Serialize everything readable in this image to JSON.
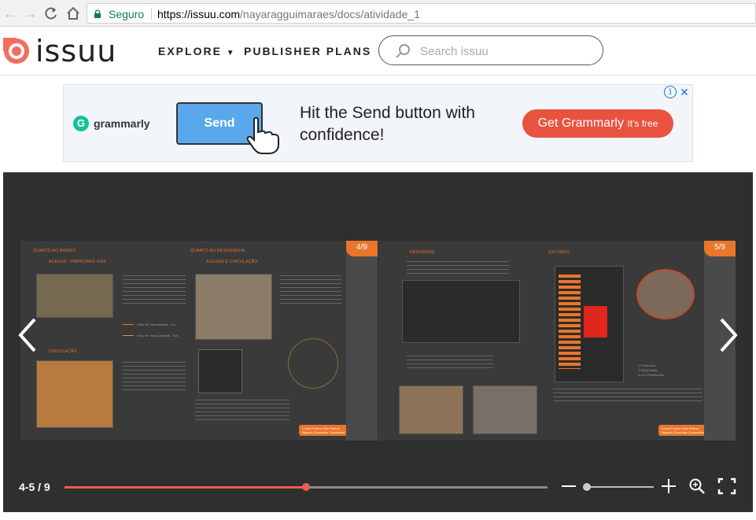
{
  "browser": {
    "secure_label": "Seguro",
    "url_host": "https://issuu.com",
    "url_path": "/nayaragguimaraes/docs/atividade_1"
  },
  "header": {
    "logo_text": "issuu",
    "nav": {
      "explore": "EXPLORE",
      "publisher_plans": "PUBLISHER PLANS"
    },
    "search_placeholder": "Search issuu"
  },
  "ad": {
    "brand": "grammarly",
    "button_text": "Send",
    "headline": "Hit the Send button with confidence!",
    "cta": "Get Grammarly",
    "cta_suffix": "It's free",
    "info_icon": "info-icon",
    "close_icon": "close-icon"
  },
  "reader": {
    "page_indicator": "4-5 / 9",
    "progress_fraction": 0.5,
    "zoom_fraction": 0.0,
    "left_page": {
      "tab": "4/9",
      "section_a": "QUARTO AO BAIRRO",
      "section_b": "QUARTO AO RESIDENCIAL",
      "label_access": "ACESSO - PRINCIPAIS VIAS",
      "label_access2": "ACESSO E CIRCULAÇÃO",
      "label_circulation": "CIRCULAÇÃO",
      "legend_1": "Setor de Vias Arteriais - Sol.",
      "legend_2": "Setor de Vias Coletoras - Sol.",
      "credit": "Lucas Franco; Dan Ramos\nNayara; Fernanda; Guimarães"
    },
    "right_page": {
      "tab": "5/9",
      "label_density": "DENSIDADE",
      "label_surroundings": "ENTORNO",
      "legend_1": "1 Pavimento",
      "legend_2": "2 Pavimentos",
      "legend_3": "3 ou 4 Pavimentos",
      "credit": "Lucas Franco; Dan Ramos\nNayara; Fernanda; Guimarães"
    }
  }
}
